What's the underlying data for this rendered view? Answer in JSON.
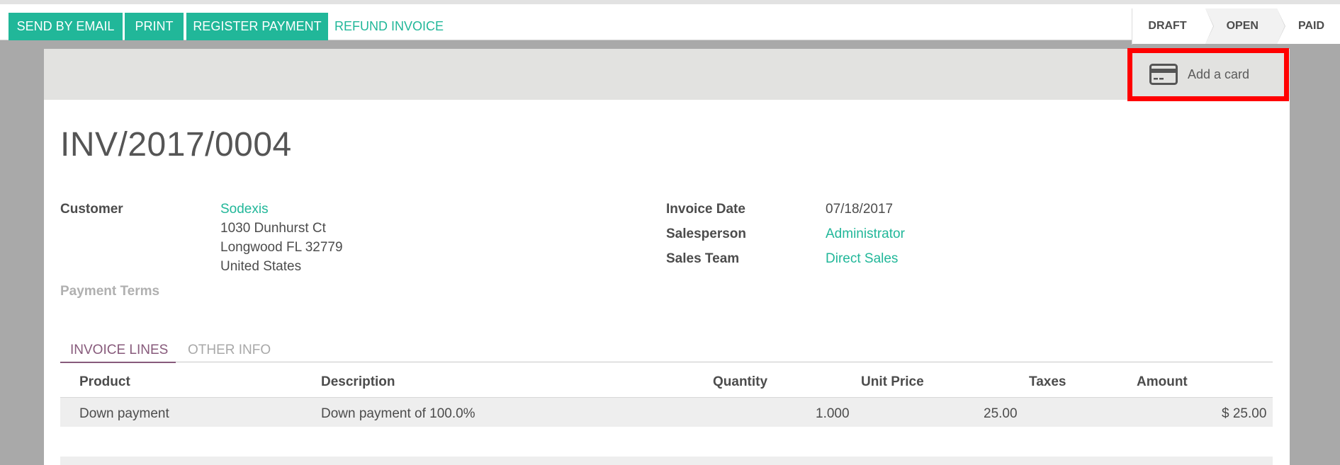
{
  "toolbar": {
    "send_email": "SEND BY EMAIL",
    "print": "PRINT",
    "register_payment": "REGISTER PAYMENT",
    "refund_invoice": "REFUND INVOICE"
  },
  "status": {
    "stages": [
      "DRAFT",
      "OPEN",
      "PAID"
    ],
    "active": "OPEN"
  },
  "sheet_header": {
    "add_card_label": "Add a card",
    "add_card_icon": "credit-card-icon"
  },
  "invoice": {
    "number": "INV/2017/0004",
    "customer_label": "Customer",
    "customer_name": "Sodexis",
    "address_line1": "1030 Dunhurst Ct",
    "address_line2": "Longwood FL 32779",
    "address_line3": "United States",
    "payment_terms_label": "Payment Terms",
    "invoice_date_label": "Invoice Date",
    "invoice_date": "07/18/2017",
    "salesperson_label": "Salesperson",
    "salesperson": "Administrator",
    "sales_team_label": "Sales Team",
    "sales_team": "Direct Sales"
  },
  "tabs": {
    "invoice_lines": "INVOICE LINES",
    "other_info": "OTHER INFO"
  },
  "table": {
    "columns": [
      "Product",
      "Description",
      "Quantity",
      "Unit Price",
      "Taxes",
      "Amount"
    ],
    "rows": [
      {
        "product": "Down payment",
        "description": "Down payment of 100.0%",
        "quantity": "1.000",
        "unit_price": "25.00",
        "taxes": "",
        "amount": "$ 25.00"
      }
    ]
  },
  "colors": {
    "accent": "#21b799",
    "tab_active": "#875a7b",
    "highlight": "#ff0000"
  }
}
